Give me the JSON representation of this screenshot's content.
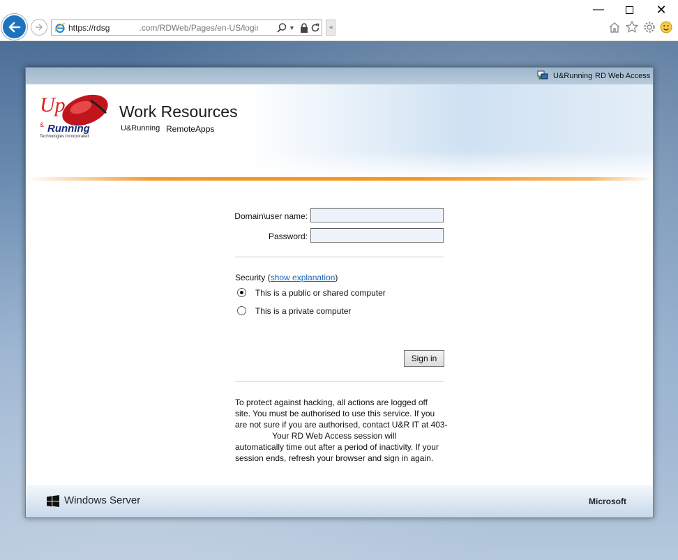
{
  "browser": {
    "address_main": "https://rdsg",
    "address_rest": ".com/RDWeb/Pages/en-US/login.asp",
    "window_controls": {
      "minimize": "—",
      "close": "✕"
    },
    "toolbar_icons": [
      "home-icon",
      "favorites-star-icon",
      "settings-gear-icon",
      "feedback-smiley-icon"
    ]
  },
  "topbar": {
    "org": "U&Running",
    "app": "RD Web Access"
  },
  "header": {
    "title": "Work Resources",
    "subtitle_org": "U&Running",
    "subtitle_app": "RemoteApps",
    "logo": {
      "line1": "Up",
      "line2": "Running",
      "tagline": "Technologies Incorporated"
    }
  },
  "form": {
    "user_label": "Domain\\user name:",
    "user_value": "",
    "password_label": "Password:",
    "password_value": "",
    "security_prefix": "Security (",
    "security_link": "show explanation",
    "security_suffix": ")",
    "options": [
      {
        "label": "This is a public or shared computer",
        "selected": true
      },
      {
        "label": "This is a private computer",
        "selected": false
      }
    ],
    "signin_label": "Sign in"
  },
  "notice": {
    "lines": [
      "To protect against hacking, all actions are logged off",
      "site. You must be authorised to use this service. If you",
      "are not sure if you are authorised, contact U&R IT at 403-",
      "                Your RD Web Access session will",
      "automatically time out after a period of inactivity. If your",
      "session ends, refresh your browser and sign in again."
    ]
  },
  "footer": {
    "left": "Windows Server",
    "right": "Microsoft"
  },
  "colors": {
    "accent_orange": "#f7931e",
    "link_blue": "#1864b4",
    "back_button": "#1e73be"
  }
}
